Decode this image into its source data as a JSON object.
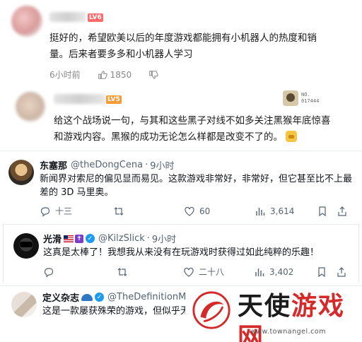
{
  "bili": {
    "comment1": {
      "level": "LV6",
      "text_line1": "挺好的，希望欧美以后的年度游戏都能拥有小机器人的热度和销",
      "text_line2": "量。后来者要多多和小机器人学习",
      "time": "6小时前",
      "likes": "1850"
    },
    "comment2": {
      "level": "LV5",
      "badge_no": "NO.",
      "badge_num": "017444",
      "text_line1": "给这个战场说一句，与其和这些黑子对线不如多关注黑猴年底惊喜",
      "text_line2": "和游戏内容。黑猴的成功无论怎么样都是改变不了的。"
    }
  },
  "tweets": [
    {
      "name": "东塞那",
      "handle": "@theDongCena",
      "time": "9小时",
      "text_line1": "新闻界对索尼的偏见显而易见。这款游戏非常好，非常好，但它甚至比不上最",
      "text_line2": "差的 3D 马里奥。",
      "replies": "十三",
      "retweets": "",
      "likes": "60",
      "views": "3,614"
    },
    {
      "name": "光滑",
      "handle": "@KilzSlick",
      "time": "9小时",
      "text_line1": "这真是太棒了！我想我从来没有在玩游戏时获得过如此纯粹的乐趣！",
      "replies": "",
      "retweets": "",
      "likes": "二十八",
      "views": "3,402"
    },
    {
      "name": "定义杂志",
      "handle": "@TheDefinitionMg",
      "time": "5",
      "text_line1": "这是一款屡获殊荣的游戏，但似乎无"
    }
  ],
  "watermark": {
    "text_a": "天使",
    "text_b": "游戏网",
    "url": "www.townangel.com",
    "accent": "#d42a2a"
  },
  "colors": {
    "text": "#0f1419",
    "muted": "#536471",
    "verified": "#1d9bf0",
    "level": "#ff6b6b"
  }
}
